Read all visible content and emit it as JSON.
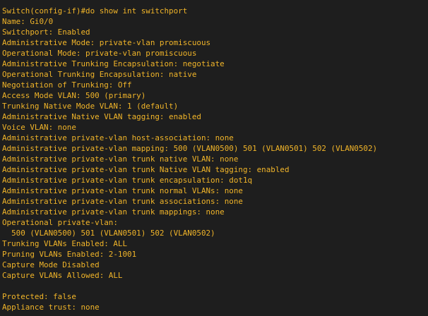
{
  "terminal": {
    "text_color": "#f0b429",
    "background_color": "#1e1e1e",
    "lines": [
      "Switch(config-if)#do show int switchport",
      "Name: Gi0/0",
      "Switchport: Enabled",
      "Administrative Mode: private-vlan promiscuous",
      "Operational Mode: private-vlan promiscuous",
      "Administrative Trunking Encapsulation: negotiate",
      "Operational Trunking Encapsulation: native",
      "Negotiation of Trunking: Off",
      "Access Mode VLAN: 500 (primary)",
      "Trunking Native Mode VLAN: 1 (default)",
      "Administrative Native VLAN tagging: enabled",
      "Voice VLAN: none",
      "Administrative private-vlan host-association: none",
      "Administrative private-vlan mapping: 500 (VLAN0500) 501 (VLAN0501) 502 (VLAN0502)",
      "Administrative private-vlan trunk native VLAN: none",
      "Administrative private-vlan trunk Native VLAN tagging: enabled",
      "Administrative private-vlan trunk encapsulation: dot1q",
      "Administrative private-vlan trunk normal VLANs: none",
      "Administrative private-vlan trunk associations: none",
      "Administrative private-vlan trunk mappings: none",
      "Operational private-vlan:",
      "  500 (VLAN0500) 501 (VLAN0501) 502 (VLAN0502)",
      "Trunking VLANs Enabled: ALL",
      "Pruning VLANs Enabled: 2-1001",
      "Capture Mode Disabled",
      "Capture VLANs Allowed: ALL",
      "",
      "Protected: false",
      "Appliance trust: none"
    ]
  }
}
